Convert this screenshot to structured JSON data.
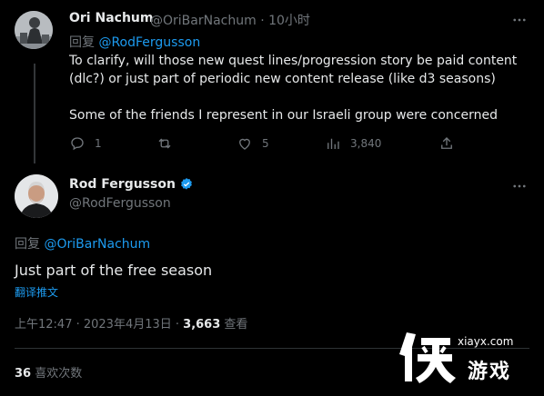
{
  "reply_tweet": {
    "author_name": "Ori Nachum",
    "author_handle": "@OriBarNachum",
    "separator": "·",
    "time": "10小时",
    "reply_prefix": "回复",
    "reply_to": "@RodFergusson",
    "paragraphs": [
      "To clarify, will those new quest lines/progression story be paid content (dlc?) or just part of periodic new content release (like d3 seasons)",
      "Some of the friends I represent in our Israeli group were concerned"
    ],
    "actions": {
      "replies": "1",
      "retweets": "",
      "likes": "5",
      "views": "3,840"
    }
  },
  "main_tweet": {
    "author_name": "Rod Fergusson",
    "author_handle": "@RodFergusson",
    "verified": true,
    "reply_prefix": "回复",
    "reply_to": "@OriBarNachum",
    "text": "Just part of the free season",
    "translate_label": "翻译推文",
    "timestamp": "上午12:47 · 2023年4月13日 · ",
    "view_count": "3,663",
    "view_label": " 查看",
    "like_count": "36",
    "like_label": " 喜欢次数"
  },
  "watermark": {
    "url": "xiayx.com",
    "logo_char": "侠",
    "text": "游戏"
  },
  "colors": {
    "background": "#000000",
    "text": "#e7e9ea",
    "muted": "#71767b",
    "accent": "#1d9bf0",
    "divider": "#2f3336"
  }
}
